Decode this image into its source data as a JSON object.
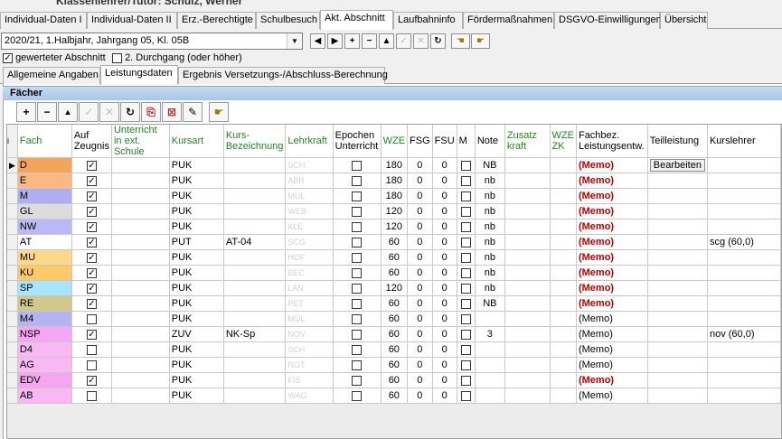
{
  "header": {
    "text": "Klassenlehrer/Tutor: Schulz, Werner"
  },
  "main_tabs": [
    {
      "label": "Individual-Daten I"
    },
    {
      "label": "Individual-Daten II"
    },
    {
      "label": "Erz.-Berechtigte"
    },
    {
      "label": "Schulbesuch"
    },
    {
      "label": "Akt. Abschnitt",
      "active": true
    },
    {
      "label": "Laufbahninfo"
    },
    {
      "label": "Fördermaßnahmen"
    },
    {
      "label": "DSGVO-Einwilligungen"
    },
    {
      "label": "Übersicht"
    }
  ],
  "section": {
    "selected": "2020/21, 1.Halbjahr, Jahrgang 05, Kl. 05B"
  },
  "checks": {
    "gewertet_label": "gewerteter Abschnitt",
    "gewertet": true,
    "durchgang_label": "2. Durchgang (oder höher)",
    "durchgang": false
  },
  "sub_tabs": [
    {
      "label": "Allgemeine Angaben"
    },
    {
      "label": "Leistungsdaten",
      "active": true
    },
    {
      "label": "Ergebnis Versetzungs-/Abschluss-Berechnung"
    }
  ],
  "panel": {
    "title": "Fächer",
    "indicator": "i"
  },
  "columns": {
    "fach": "Fach",
    "zeugnis": "Auf Zeugnis",
    "extern": "Unterricht in ext. Schule",
    "kursart": "Kursart",
    "kursbez": "Kurs-Bezeichnung",
    "lehrkraft": "Lehrkraft",
    "epochen": "Epochen Unterricht",
    "wze": "WZE",
    "fsg": "FSG",
    "fsu": "FSU",
    "m": "M",
    "note": "Note",
    "zusatz": "Zusatz kraft",
    "wzezk": "WZE ZK",
    "fachbez": "Fachbez. Leistungsentw.",
    "teil": "Teilleistung",
    "kurslehrer": "Kurslehrer"
  },
  "rows": [
    {
      "fach": "D",
      "color": "#f5a55a",
      "zeugnis": true,
      "kursart": "PUK",
      "kursbez": "",
      "lehrkraft": "SCH",
      "epochen": false,
      "wze": "180",
      "fsg": "0",
      "fsu": "0",
      "note": "NB",
      "memo": "(Memo)",
      "memo_bold": true,
      "teil": "Bearbeiten",
      "kurslehrer": "",
      "current": true
    },
    {
      "fach": "E",
      "color": "#fbb882",
      "zeugnis": true,
      "kursart": "PUK",
      "kursbez": "",
      "lehrkraft": "ABR",
      "epochen": false,
      "wze": "180",
      "fsg": "0",
      "fsu": "0",
      "note": "nb",
      "memo": "(Memo)",
      "memo_bold": true,
      "teil": "",
      "kurslehrer": ""
    },
    {
      "fach": "M",
      "color": "#aeaef0",
      "zeugnis": true,
      "kursart": "PUK",
      "kursbez": "",
      "lehrkraft": "MÜL",
      "epochen": false,
      "wze": "180",
      "fsg": "0",
      "fsu": "0",
      "note": "nb",
      "memo": "(Memo)",
      "memo_bold": true,
      "teil": "",
      "kurslehrer": ""
    },
    {
      "fach": "GL",
      "color": "#dcdcdc",
      "zeugnis": true,
      "kursart": "PUK",
      "kursbez": "",
      "lehrkraft": "WEB",
      "epochen": false,
      "wze": "120",
      "fsg": "0",
      "fsu": "0",
      "note": "nb",
      "memo": "(Memo)",
      "memo_bold": true,
      "teil": "",
      "kurslehrer": ""
    },
    {
      "fach": "NW",
      "color": "#b9b9f5",
      "zeugnis": true,
      "kursart": "PUK",
      "kursbez": "",
      "lehrkraft": "KLE",
      "epochen": false,
      "wze": "120",
      "fsg": "0",
      "fsu": "0",
      "note": "nb",
      "memo": "(Memo)",
      "memo_bold": true,
      "teil": "",
      "kurslehrer": ""
    },
    {
      "fach": "AT",
      "color": "#ffffff",
      "zeugnis": true,
      "kursart": "PUT",
      "kursbez": "AT-04",
      "lehrkraft": "SCG",
      "epochen": false,
      "wze": "60",
      "fsg": "0",
      "fsu": "0",
      "note": "nb",
      "memo": "(Memo)",
      "memo_bold": true,
      "teil": "",
      "kurslehrer": "scg (60,0)"
    },
    {
      "fach": "MU",
      "color": "#ffd88a",
      "zeugnis": true,
      "kursart": "PUK",
      "kursbez": "",
      "lehrkraft": "HOF",
      "epochen": false,
      "wze": "60",
      "fsg": "0",
      "fsu": "0",
      "note": "nb",
      "memo": "(Memo)",
      "memo_bold": true,
      "teil": "",
      "kurslehrer": ""
    },
    {
      "fach": "KU",
      "color": "#ffc868",
      "zeugnis": true,
      "kursart": "PUK",
      "kursbez": "",
      "lehrkraft": "BEC",
      "epochen": false,
      "wze": "60",
      "fsg": "0",
      "fsu": "0",
      "note": "nb",
      "memo": "(Memo)",
      "memo_bold": true,
      "teil": "",
      "kurslehrer": ""
    },
    {
      "fach": "SP",
      "color": "#a6e6f8",
      "zeugnis": true,
      "kursart": "PUK",
      "kursbez": "",
      "lehrkraft": "LAN",
      "epochen": false,
      "wze": "120",
      "fsg": "0",
      "fsu": "0",
      "note": "nb",
      "memo": "(Memo)",
      "memo_bold": true,
      "teil": "",
      "kurslehrer": ""
    },
    {
      "fach": "RE",
      "color": "#d2c88c",
      "zeugnis": true,
      "kursart": "PUK",
      "kursbez": "",
      "lehrkraft": "PET",
      "epochen": false,
      "wze": "60",
      "fsg": "0",
      "fsu": "0",
      "note": "NB",
      "memo": "(Memo)",
      "memo_bold": true,
      "teil": "",
      "kurslehrer": ""
    },
    {
      "fach": "M4",
      "color": "#b4b4f0",
      "zeugnis": false,
      "kursart": "PUK",
      "kursbez": "",
      "lehrkraft": "MÜL",
      "epochen": false,
      "wze": "60",
      "fsg": "0",
      "fsu": "0",
      "note": "",
      "memo": "(Memo)",
      "memo_bold": false,
      "teil": "",
      "kurslehrer": ""
    },
    {
      "fach": "NSP",
      "color": "#f5a6f0",
      "zeugnis": true,
      "kursart": "ZUV",
      "kursbez": "NK-Sp",
      "lehrkraft": "NOV",
      "epochen": false,
      "wze": "60",
      "fsg": "0",
      "fsu": "0",
      "note": "3",
      "memo": "(Memo)",
      "memo_bold": false,
      "teil": "",
      "kurslehrer": "nov (60,0)"
    },
    {
      "fach": "D4",
      "color": "#f8b8f2",
      "zeugnis": false,
      "kursart": "PUK",
      "kursbez": "",
      "lehrkraft": "SCH",
      "epochen": false,
      "wze": "60",
      "fsg": "0",
      "fsu": "0",
      "note": "",
      "memo": "(Memo)",
      "memo_bold": false,
      "teil": "",
      "kurslehrer": ""
    },
    {
      "fach": "AG",
      "color": "#f8b8f2",
      "zeugnis": false,
      "kursart": "PUK",
      "kursbez": "",
      "lehrkraft": "ROT",
      "epochen": false,
      "wze": "60",
      "fsg": "0",
      "fsu": "0",
      "note": "",
      "memo": "(Memo)",
      "memo_bold": false,
      "teil": "",
      "kurslehrer": ""
    },
    {
      "fach": "EDV",
      "color": "#f5a6f0",
      "zeugnis": true,
      "kursart": "PUK",
      "kursbez": "",
      "lehrkraft": "FIS",
      "epochen": false,
      "wze": "60",
      "fsg": "0",
      "fsu": "0",
      "note": "",
      "memo": "(Memo)",
      "memo_bold": true,
      "teil": "",
      "kurslehrer": ""
    },
    {
      "fach": "AB",
      "color": "#f8b8f2",
      "zeugnis": false,
      "kursart": "PUK",
      "kursbez": "",
      "lehrkraft": "WAG",
      "epochen": false,
      "wze": "60",
      "fsg": "0",
      "fsu": "0",
      "note": "",
      "memo": "(Memo)",
      "memo_bold": false,
      "teil": "",
      "kurslehrer": ""
    }
  ]
}
